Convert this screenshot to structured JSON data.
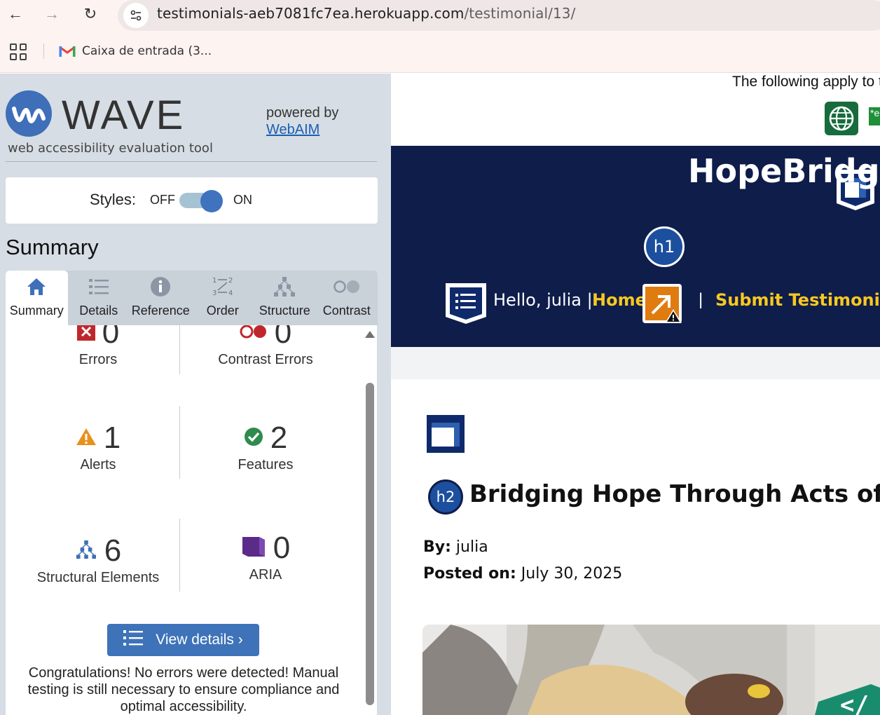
{
  "browser": {
    "url_host": "testimonials-aeb7081fc7ea.herokuapp.com",
    "url_path": "/testimonial/13/",
    "bookmark_label": "Caixa de entrada (3..."
  },
  "wave": {
    "title": "WAVE",
    "subtitle": "web accessibility evaluation tool",
    "powered_by": "powered by",
    "webaim_link": "WebAIM",
    "styles_label": "Styles:",
    "styles_off": "OFF",
    "styles_on": "ON",
    "summary_heading": "Summary",
    "tabs": [
      {
        "label": "Summary",
        "icon": "home-icon"
      },
      {
        "label": "Details",
        "icon": "list-icon"
      },
      {
        "label": "Reference",
        "icon": "info-icon"
      },
      {
        "label": "Order",
        "icon": "order-icon"
      },
      {
        "label": "Structure",
        "icon": "structure-icon"
      },
      {
        "label": "Contrast",
        "icon": "contrast-icon"
      }
    ],
    "stats": {
      "errors": {
        "count": "0",
        "label": "Errors"
      },
      "contrast_errors": {
        "count": "0",
        "label": "Contrast Errors"
      },
      "alerts": {
        "count": "1",
        "label": "Alerts"
      },
      "features": {
        "count": "2",
        "label": "Features"
      },
      "structural": {
        "count": "6",
        "label": "Structural Elements"
      },
      "aria": {
        "count": "0",
        "label": "ARIA"
      }
    },
    "view_details": "View details ›",
    "congrats": "Congratulations! No errors were detected! Manual testing is still necessary to ensure compliance and optimal accessibility."
  },
  "page": {
    "apply_text": "The following apply to t",
    "green_tag": "*e",
    "brand": "HopeBridge",
    "h1_badge": "h1",
    "h2_badge": "h2",
    "hello": "Hello, julia |",
    "nav_home": "Home",
    "nav_sep": "|",
    "nav_submit": "Submit Testimonial",
    "article_title": "Bridging Hope Through Acts of Kin",
    "by_label": "By:",
    "by_value": "julia",
    "posted_label": "Posted on:",
    "posted_value": "July 30, 2025"
  },
  "colors": {
    "wave_panel_bg": "#d6dde4",
    "wave_blue": "#3e73b9",
    "hero_navy": "#0f1d4b",
    "nav_yellow": "#f8c81f"
  }
}
